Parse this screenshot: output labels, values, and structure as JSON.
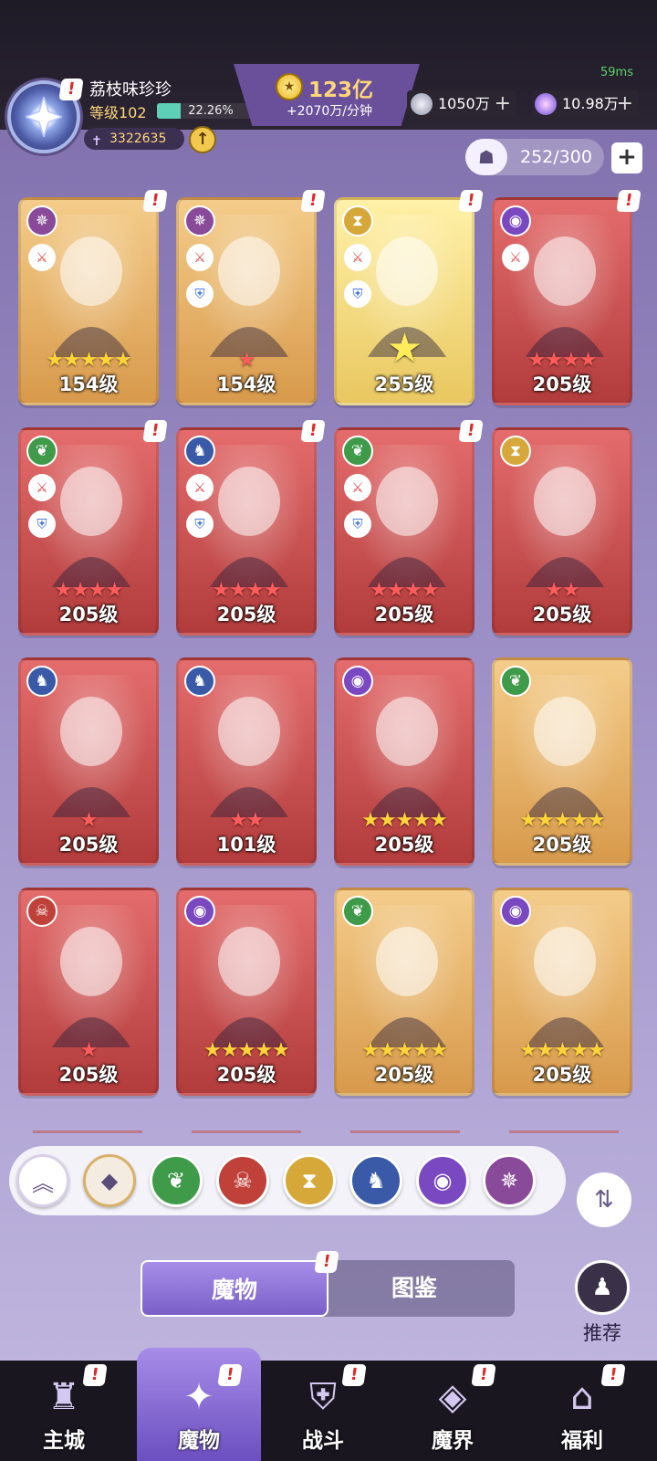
{
  "status": {
    "fps": "59ms"
  },
  "player": {
    "name": "荔枝味珍珍",
    "level_label": "等级102",
    "exp_percent": "22.26%",
    "exp_fraction": 0.2226,
    "power": "3322635"
  },
  "currency": {
    "gold": "123亿",
    "gold_rate": "+2070万/分钟",
    "silver": "1050万",
    "gems": "10.98万"
  },
  "capacity": {
    "text": "252/300"
  },
  "cards": [
    {
      "level": "154级",
      "stars": 5,
      "star_color": "gold",
      "rarity": "gold",
      "element": "vortex",
      "roles": [
        "attack"
      ],
      "alert": true
    },
    {
      "level": "154级",
      "stars": 1,
      "star_color": "red",
      "rarity": "gold",
      "element": "vortex",
      "roles": [
        "attack",
        "defense"
      ],
      "alert": true
    },
    {
      "level": "255级",
      "stars": 1,
      "star_color": "yellow",
      "rarity": "yellow",
      "element": "hourglass",
      "roles": [
        "attack",
        "defense"
      ],
      "alert": true
    },
    {
      "level": "205级",
      "stars": 4,
      "star_color": "red",
      "rarity": "red",
      "element": "eye",
      "roles": [
        "attack"
      ],
      "alert": true
    },
    {
      "level": "205级",
      "stars": 4,
      "star_color": "red",
      "rarity": "red",
      "element": "leaf",
      "roles": [
        "attack",
        "defense"
      ],
      "alert": true
    },
    {
      "level": "205级",
      "stars": 4,
      "star_color": "red",
      "rarity": "red",
      "element": "dragon",
      "roles": [
        "attack",
        "defense"
      ],
      "alert": true
    },
    {
      "level": "205级",
      "stars": 4,
      "star_color": "red",
      "rarity": "red",
      "element": "leaf",
      "roles": [
        "attack",
        "defense"
      ],
      "alert": true
    },
    {
      "level": "205级",
      "stars": 2,
      "star_color": "red",
      "rarity": "red",
      "element": "hourglass",
      "roles": [],
      "alert": false
    },
    {
      "level": "205级",
      "stars": 1,
      "star_color": "red",
      "rarity": "red",
      "element": "dragon",
      "roles": [],
      "alert": false
    },
    {
      "level": "101级",
      "stars": 2,
      "star_color": "red",
      "rarity": "red",
      "element": "dragon",
      "roles": [],
      "alert": false
    },
    {
      "level": "205级",
      "stars": 5,
      "star_color": "gold",
      "rarity": "red",
      "element": "eye",
      "roles": [],
      "alert": false
    },
    {
      "level": "205级",
      "stars": 5,
      "star_color": "gold",
      "rarity": "gold",
      "element": "leaf",
      "roles": [],
      "alert": false
    },
    {
      "level": "205级",
      "stars": 1,
      "star_color": "red",
      "rarity": "red",
      "element": "demon",
      "roles": [],
      "alert": false
    },
    {
      "level": "205级",
      "stars": 5,
      "star_color": "gold",
      "rarity": "red",
      "element": "eye",
      "roles": [],
      "alert": false
    },
    {
      "level": "205级",
      "stars": 5,
      "star_color": "gold",
      "rarity": "gold",
      "element": "leaf",
      "roles": [],
      "alert": false
    },
    {
      "level": "205级",
      "stars": 5,
      "star_color": "gold",
      "rarity": "gold",
      "element": "eye",
      "roles": [],
      "alert": false
    }
  ],
  "filters": [
    {
      "id": "collapse",
      "icon": "double-chevron-up-icon",
      "color": "#ffffff"
    },
    {
      "id": "all",
      "icon": "diamond-grid-icon",
      "color": "#f4ece0"
    },
    {
      "id": "leaf",
      "icon": "leaf-icon",
      "color": "#3f9a4a"
    },
    {
      "id": "demon",
      "icon": "demon-mask-icon",
      "color": "#c0403a"
    },
    {
      "id": "hourglass",
      "icon": "hourglass-icon",
      "color": "#d6a83a"
    },
    {
      "id": "dragon",
      "icon": "dragon-icon",
      "color": "#3a5aa8"
    },
    {
      "id": "eye",
      "icon": "eye-icon",
      "color": "#7a48c0"
    },
    {
      "id": "vortex",
      "icon": "vortex-icon",
      "color": "#8a4a9a"
    }
  ],
  "tabs": {
    "monsters": "魔物",
    "codex": "图鉴"
  },
  "recommend": {
    "label": "推荐"
  },
  "nav": [
    {
      "label": "主城",
      "icon": "castle-icon",
      "alert": true
    },
    {
      "label": "魔物",
      "icon": "monster-flame-icon",
      "alert": true,
      "active": true
    },
    {
      "label": "战斗",
      "icon": "battle-shield-icon",
      "alert": true
    },
    {
      "label": "魔界",
      "icon": "demon-realm-icon",
      "alert": true
    },
    {
      "label": "福利",
      "icon": "gift-chest-icon",
      "alert": true
    }
  ],
  "colors": {
    "element_vortex": "#8a4a9a",
    "element_hourglass": "#d6a83a",
    "element_eye": "#7a48c0",
    "element_leaf": "#3f9a4a",
    "element_dragon": "#3a5aa8",
    "element_demon": "#c0403a",
    "accent": "#7a5fc8",
    "alert": "#e02828"
  }
}
